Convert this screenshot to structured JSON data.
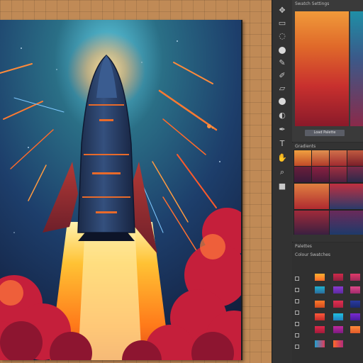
{
  "panels": {
    "swatches_title": "Swatch Settings",
    "swatches_button": "Load Palette",
    "gradients_title": "Gradients",
    "palettes_title": "Palettes",
    "color_settings_title": "Colour Swatches"
  },
  "colors": {
    "accent_orange": "#f0762a",
    "sky_deep": "#14284a",
    "sky_teal": "#2a6f86",
    "rocket_body": "#263a5f",
    "flame_yellow": "#ffd24a",
    "cloud_red": "#c51f3b"
  },
  "icons": [
    "move-icon",
    "marquee-icon",
    "lasso-icon",
    "crop-icon",
    "eyedropper-icon",
    "brush-icon",
    "eraser-icon",
    "fill-icon",
    "dodge-icon",
    "pen-icon",
    "type-icon",
    "hand-icon",
    "zoom-icon",
    "color-chip-icon"
  ]
}
